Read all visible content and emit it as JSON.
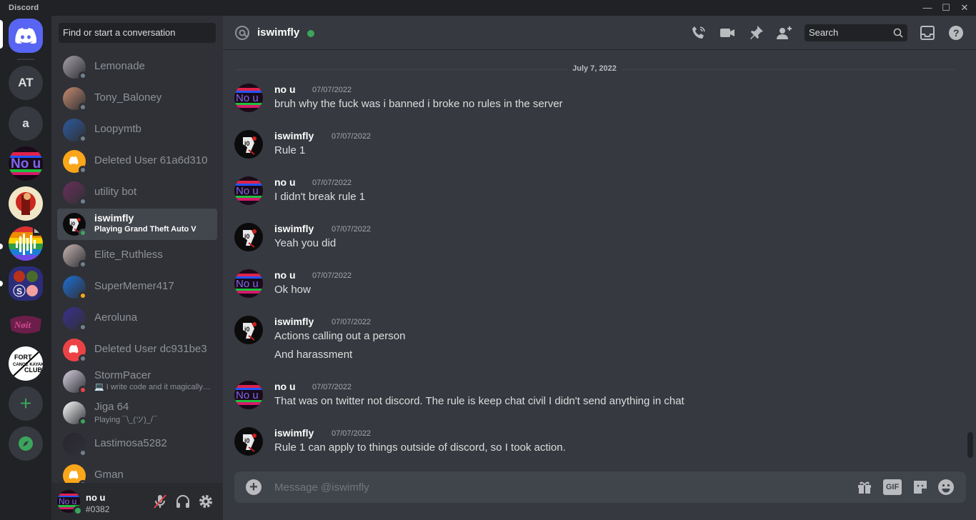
{
  "window": {
    "brand": "Discord",
    "min": "—",
    "max": "☐",
    "close": "✕"
  },
  "servers": [
    {
      "name": "home",
      "icon": "discord-logo-icon"
    },
    {
      "name": "AT"
    },
    {
      "name": "a"
    },
    {
      "name": "no-u-server"
    },
    {
      "name": "red-character-server"
    },
    {
      "name": "rainbow-audio-server"
    },
    {
      "name": "grid-server"
    },
    {
      "name": "pink-logo-server"
    },
    {
      "name": "fort-canoe-kayak-club"
    },
    {
      "name": "add-server",
      "glyph": "+"
    },
    {
      "name": "explore",
      "icon": "compass-icon"
    }
  ],
  "dm": {
    "search_placeholder": "Find or start a conversation",
    "items": [
      {
        "name": "Lemonade",
        "status": "offline"
      },
      {
        "name": "Tony_Baloney",
        "status": "offline"
      },
      {
        "name": "Loopymtb",
        "status": "offline"
      },
      {
        "name": "Deleted User 61a6d310",
        "status": "offline"
      },
      {
        "name": "utility bot",
        "status": "offline"
      },
      {
        "name": "iswimfly",
        "status": "online",
        "sub": "Playing Grand Theft Auto V",
        "active": true
      },
      {
        "name": "Elite_Ruthless",
        "status": "offline"
      },
      {
        "name": "SuperMemer417",
        "status": "idle"
      },
      {
        "name": "Aeroluna",
        "status": "offline"
      },
      {
        "name": "Deleted User dc931be3",
        "status": "offline"
      },
      {
        "name": "StormPacer",
        "status": "dnd",
        "sub": "💻 I write code and it magically works"
      },
      {
        "name": "Jiga 64",
        "status": "online",
        "sub": "Playing ¯\\_(ツ)_/¯"
      },
      {
        "name": "Lastimosa5282",
        "status": "offline"
      },
      {
        "name": "Gman",
        "status": "offline"
      }
    ]
  },
  "user": {
    "name": "no u",
    "tag": "#0382"
  },
  "header": {
    "title": "iswimfly",
    "search_placeholder": "Search"
  },
  "chat": {
    "date_divider": "July 7, 2022",
    "messages": [
      {
        "author": "no u",
        "timestamp": "07/07/2022",
        "lines": [
          "bruh why the fuck was i banned i broke no rules in the server"
        ],
        "avatar": "no-u"
      },
      {
        "author": "iswimfly",
        "timestamp": "07/07/2022",
        "lines": [
          "Rule 1"
        ],
        "avatar": "iswimfly"
      },
      {
        "author": "no u",
        "timestamp": "07/07/2022",
        "lines": [
          "I didn't break rule 1"
        ],
        "avatar": "no-u"
      },
      {
        "author": "iswimfly",
        "timestamp": "07/07/2022",
        "lines": [
          "Yeah you did"
        ],
        "avatar": "iswimfly"
      },
      {
        "author": "no u",
        "timestamp": "07/07/2022",
        "lines": [
          "Ok how"
        ],
        "avatar": "no-u"
      },
      {
        "author": "iswimfly",
        "timestamp": "07/07/2022",
        "lines": [
          "Actions calling out a person",
          "And harassment"
        ],
        "avatar": "iswimfly"
      },
      {
        "author": "no u",
        "timestamp": "07/07/2022",
        "lines": [
          "That was on twitter not discord. The rule is keep chat civil I didn't send anything in chat"
        ],
        "avatar": "no-u"
      },
      {
        "author": "iswimfly",
        "timestamp": "07/07/2022",
        "lines": [
          "Rule 1 can apply to things outside of discord, so I took action."
        ],
        "avatar": "iswimfly"
      }
    ],
    "composer_placeholder": "Message @iswimfly",
    "gif_label": "GIF"
  },
  "colors": {
    "online": "#3ba55d",
    "idle": "#faa81a",
    "dnd": "#ed4245",
    "offline": "#747f8d",
    "brand": "#5865f2"
  }
}
